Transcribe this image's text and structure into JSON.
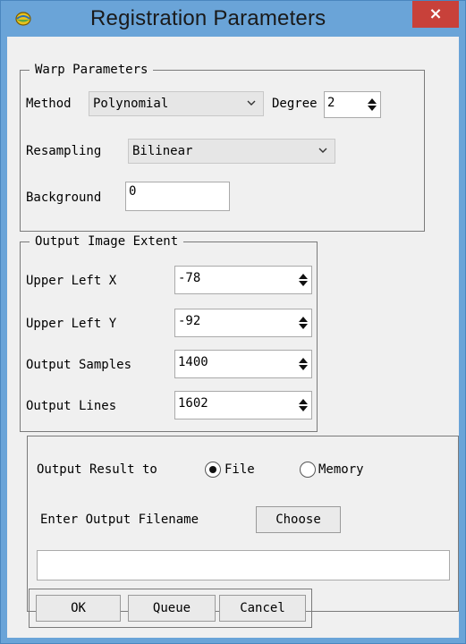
{
  "window": {
    "title": "Registration Parameters",
    "close_label": "×"
  },
  "warp": {
    "legend": "Warp Parameters",
    "method_label": "Method",
    "method_value": "Polynomial",
    "degree_label": "Degree",
    "degree_value": "2",
    "resampling_label": "Resampling",
    "resampling_value": "Bilinear",
    "background_label": "Background",
    "background_value": "0"
  },
  "extent": {
    "legend": "Output Image Extent",
    "rows": [
      {
        "label": "Upper Left X",
        "value": "-78"
      },
      {
        "label": "Upper Left Y",
        "value": "-92"
      },
      {
        "label": "Output Samples",
        "value": "1400"
      },
      {
        "label": "Output Lines",
        "value": "1602"
      }
    ]
  },
  "output": {
    "result_label": "Output Result to",
    "file_label": "File",
    "memory_label": "Memory",
    "selected": "File",
    "filename_label": "Enter Output Filename",
    "choose_label": "Choose",
    "filename_value": ""
  },
  "buttons": {
    "ok": "OK",
    "queue": "Queue",
    "cancel": "Cancel"
  }
}
